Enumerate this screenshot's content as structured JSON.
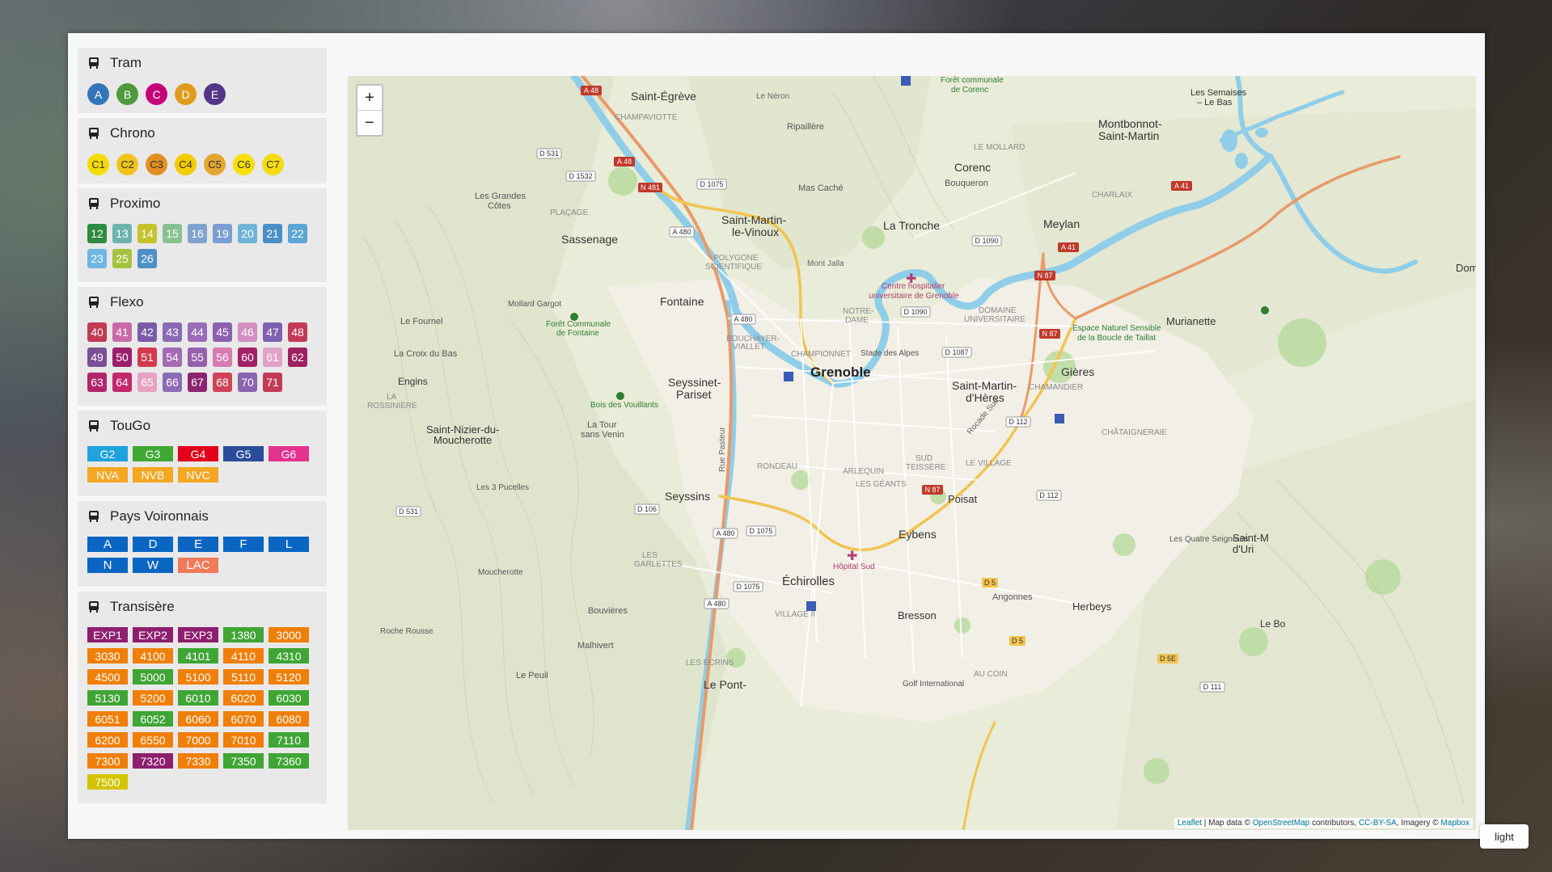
{
  "groups": {
    "tram": {
      "title": "Tram",
      "lines": [
        {
          "label": "A",
          "color": "#3376b8"
        },
        {
          "label": "B",
          "color": "#4e9a3e"
        },
        {
          "label": "C",
          "color": "#c4007a"
        },
        {
          "label": "D",
          "color": "#df9c1e"
        },
        {
          "label": "E",
          "color": "#533786"
        }
      ]
    },
    "chrono": {
      "title": "Chrono",
      "lines": [
        {
          "label": "C1",
          "color": "#f3dc00"
        },
        {
          "label": "C2",
          "color": "#f0c41a"
        },
        {
          "label": "C3",
          "color": "#e29022"
        },
        {
          "label": "C4",
          "color": "#f3cc00"
        },
        {
          "label": "C5",
          "color": "#e3a632"
        },
        {
          "label": "C6",
          "color": "#f7df0a"
        },
        {
          "label": "C7",
          "color": "#f5dc10"
        }
      ]
    },
    "proximo": {
      "title": "Proximo",
      "lines": [
        {
          "label": "12",
          "color": "#2e8b3e"
        },
        {
          "label": "13",
          "color": "#6cb3b0"
        },
        {
          "label": "14",
          "color": "#c4c42a"
        },
        {
          "label": "15",
          "color": "#86c18f"
        },
        {
          "label": "16",
          "color": "#7fa3cf"
        },
        {
          "label": "19",
          "color": "#7a9ed4"
        },
        {
          "label": "20",
          "color": "#6fb4d7"
        },
        {
          "label": "21",
          "color": "#4a8ec7"
        },
        {
          "label": "22",
          "color": "#5aa6d6"
        },
        {
          "label": "23",
          "color": "#6fb6e2"
        },
        {
          "label": "25",
          "color": "#a5c33f"
        },
        {
          "label": "26",
          "color": "#4f90c9"
        }
      ]
    },
    "flexo": {
      "title": "Flexo",
      "lines": [
        {
          "label": "40",
          "color": "#c23a55"
        },
        {
          "label": "41",
          "color": "#c86aa8"
        },
        {
          "label": "42",
          "color": "#7a5aa8"
        },
        {
          "label": "43",
          "color": "#8a6ab4"
        },
        {
          "label": "44",
          "color": "#9a6bb8"
        },
        {
          "label": "45",
          "color": "#8c5fb0"
        },
        {
          "label": "46",
          "color": "#d38fbf"
        },
        {
          "label": "47",
          "color": "#7e5fb0"
        },
        {
          "label": "48",
          "color": "#c23a55"
        },
        {
          "label": "49",
          "color": "#7a4f96"
        },
        {
          "label": "50",
          "color": "#9b1f6e"
        },
        {
          "label": "51",
          "color": "#d33a4d"
        },
        {
          "label": "54",
          "color": "#a46bb3"
        },
        {
          "label": "55",
          "color": "#9560a9"
        },
        {
          "label": "56",
          "color": "#d77ab0"
        },
        {
          "label": "60",
          "color": "#a2226a"
        },
        {
          "label": "61",
          "color": "#e1a1c8"
        },
        {
          "label": "62",
          "color": "#9d2261"
        },
        {
          "label": "63",
          "color": "#b0266c"
        },
        {
          "label": "64",
          "color": "#c3286c"
        },
        {
          "label": "65",
          "color": "#e6a2c0"
        },
        {
          "label": "66",
          "color": "#8c6bb6"
        },
        {
          "label": "67",
          "color": "#8a2570"
        },
        {
          "label": "68",
          "color": "#d0445a"
        },
        {
          "label": "70",
          "color": "#8a64ad"
        },
        {
          "label": "71",
          "color": "#c23a55"
        }
      ]
    },
    "tougo": {
      "title": "TouGo",
      "lines": [
        {
          "label": "G2",
          "color": "#1fa3dc"
        },
        {
          "label": "G3",
          "color": "#3fa834"
        },
        {
          "label": "G4",
          "color": "#e2001a"
        },
        {
          "label": "G5",
          "color": "#2a4d9b"
        },
        {
          "label": "G6",
          "color": "#e4338f"
        },
        {
          "label": "NVA",
          "color": "#f5a623"
        },
        {
          "label": "NVB",
          "color": "#f5a623"
        },
        {
          "label": "NVC",
          "color": "#f5a623"
        }
      ]
    },
    "voironnais": {
      "title": "Pays Voironnais",
      "lines": [
        {
          "label": "A",
          "color": "#0a66c2"
        },
        {
          "label": "D",
          "color": "#0a66c2"
        },
        {
          "label": "E",
          "color": "#0a66c2"
        },
        {
          "label": "F",
          "color": "#0a66c2"
        },
        {
          "label": "L",
          "color": "#0a66c2"
        },
        {
          "label": "N",
          "color": "#0a66c2"
        },
        {
          "label": "W",
          "color": "#0a66c2"
        },
        {
          "label": "LAC",
          "color": "#f07a5a"
        }
      ]
    },
    "transisere": {
      "title": "Transisère",
      "lines": [
        {
          "label": "EXP1",
          "color": "#8e1f6e"
        },
        {
          "label": "EXP2",
          "color": "#8e1f6e"
        },
        {
          "label": "EXP3",
          "color": "#8e1f6e"
        },
        {
          "label": "1380",
          "color": "#3fa535"
        },
        {
          "label": "3000",
          "color": "#f07f0a"
        },
        {
          "label": "3030",
          "color": "#f07f0a"
        },
        {
          "label": "4100",
          "color": "#f07f0a"
        },
        {
          "label": "4101",
          "color": "#3fa535"
        },
        {
          "label": "4110",
          "color": "#f07f0a"
        },
        {
          "label": "4310",
          "color": "#3fa535"
        },
        {
          "label": "4500",
          "color": "#f07f0a"
        },
        {
          "label": "5000",
          "color": "#3fa535"
        },
        {
          "label": "5100",
          "color": "#f07f0a"
        },
        {
          "label": "5110",
          "color": "#f07f0a"
        },
        {
          "label": "5120",
          "color": "#f07f0a"
        },
        {
          "label": "5130",
          "color": "#3fa535"
        },
        {
          "label": "5200",
          "color": "#f07f0a"
        },
        {
          "label": "6010",
          "color": "#3fa535"
        },
        {
          "label": "6020",
          "color": "#f07f0a"
        },
        {
          "label": "6030",
          "color": "#3fa535"
        },
        {
          "label": "6051",
          "color": "#f07f0a"
        },
        {
          "label": "6052",
          "color": "#3fa535"
        },
        {
          "label": "6060",
          "color": "#f07f0a"
        },
        {
          "label": "6070",
          "color": "#f07f0a"
        },
        {
          "label": "6080",
          "color": "#f07f0a"
        },
        {
          "label": "6200",
          "color": "#f07f0a"
        },
        {
          "label": "6550",
          "color": "#f07f0a"
        },
        {
          "label": "7000",
          "color": "#f07f0a"
        },
        {
          "label": "7010",
          "color": "#f07f0a"
        },
        {
          "label": "7110",
          "color": "#3fa535"
        },
        {
          "label": "7300",
          "color": "#f07f0a"
        },
        {
          "label": "7320",
          "color": "#8e1f6e"
        },
        {
          "label": "7330",
          "color": "#f07f0a"
        },
        {
          "label": "7350",
          "color": "#3fa535"
        },
        {
          "label": "7360",
          "color": "#3fa535"
        },
        {
          "label": "7500",
          "color": "#d4c400"
        }
      ]
    }
  },
  "map": {
    "zoom_in": "+",
    "zoom_out": "−",
    "attribution": {
      "leaflet": "Leaflet",
      "text1": " | Map data © ",
      "osm": "OpenStreetMap",
      "text2": " contributors, ",
      "license": "CC-BY-SA",
      "text3": ", Imagery © ",
      "mapbox": "Mapbox"
    },
    "places": {
      "grenoble": "Grenoble",
      "saint_egreve": "Saint-Égrève",
      "sassenage": "Sassenage",
      "fontaine": "Fontaine",
      "saint_martin_vinoux_1": "Saint-Martin-",
      "saint_martin_vinoux_2": "le-Vinoux",
      "la_tronche": "La Tronche",
      "meylan": "Meylan",
      "corenc": "Corenc",
      "montbonnot_1": "Montbonnot-",
      "montbonnot_2": "Saint-Martin",
      "seyssinet_1": "Seyssinet-",
      "seyssinet_2": "Pariset",
      "seyssins": "Seyssins",
      "echirolles": "Échirolles",
      "eybens": "Eybens",
      "poisat": "Poisat",
      "gieres": "Gières",
      "smh_1": "Saint-Martin-",
      "smh_2": "d'Hères",
      "murianette": "Murianette",
      "bresson": "Bresson",
      "herbeys": "Herbeys",
      "le_pont": "Le Pont-",
      "saint_nizier_1": "Saint-Nizier-du-",
      "saint_nizier_2": "Moucherotte",
      "engins": "Engins",
      "les_semaises_1": "Les Semaises",
      "les_semaises_2": "– Le Bas",
      "dom": "Dom",
      "saint_m_1": "Saint-M",
      "saint_m_2": "d'Uri",
      "le_bo": "Le Bo",
      "champaviotte": "CHAMPAVIOTTE",
      "placage": "PLAÇAGE",
      "le_neron": "Le Néron",
      "ripaillere": "Ripaillère",
      "mas_cache": "Mas Caché",
      "bouqueron": "Bouqueron",
      "le_mollard": "LE MOLLARD",
      "charlaix": "CHARLAIX",
      "les_grandes_cotes_1": "Les Grandes",
      "les_grandes_cotes_2": "Côtes",
      "mont_jalla": "Mont Jalla",
      "polygone_1": "POLYGONE",
      "polygone_2": "SCIENTIFIQUE",
      "chu_1": "Centre hospitalier",
      "chu_2": "universitaire de Grenoble",
      "notre_dame_1": "NOTRE-",
      "notre_dame_2": "DAME",
      "domaine_1": "DOMAINE",
      "domaine_2": "UNIVERSITAIRE",
      "espace_1": "Espace Naturel Sensible",
      "espace_2": "de la Boucle de Taillat",
      "mollard_gargot": "Mollard Gargot",
      "le_fournel": "Le Fournel",
      "foret_fontaine_1": "Forêt Communale",
      "foret_fontaine_2": "de Fontaine",
      "la_croix": "La Croix du Bas",
      "bouchayer_1": "BOUCHAYER-",
      "bouchayer_2": "VIALLET",
      "championnet": "CHAMPIONNET",
      "stade": "Stade des Alpes",
      "chamandier": "CHAMANDIER",
      "la_rossiniere_1": "LA",
      "la_rossiniere_2": "ROSSINIÈRE",
      "bois_vouillants": "Bois des Vouillants",
      "la_tour_1": "La Tour",
      "la_tour_2": "sans Venin",
      "chataigneraie": "CHÂTAIGNERAIE",
      "sud_teissere_1": "SUD",
      "sud_teissere_2": "TEISSÈRE",
      "le_village": "LE VILLAGE",
      "arlequin": "ARLEQUIN",
      "les_geants": "LES GÉANTS",
      "rondeau": "RONDEAU",
      "les_3_pucelles": "Les 3 Pucelles",
      "les_garlettes_1": "LES",
      "les_garlettes_2": "GARLETTES",
      "hopital_sud": "Hôpital Sud",
      "moucherotte": "Moucherotte",
      "bouvieres": "Bouvières",
      "malhivert": "Malhivert",
      "roche_rousse": "Roche Rousse",
      "village_ii": "VILLAGE II",
      "angonnes": "Angonnes",
      "les_quatre_seigneurs": "Les Quatre Seigneurs",
      "le_peuil": "Le Peuil",
      "les_ecrins": "LES ÉCRINS",
      "au_coin": "AU COIN",
      "golf": "Golf International",
      "foret_corenc_1": "Forêt communale",
      "foret_corenc_2": "de Corenc",
      "rocade_sud": "Rocade Sud",
      "rue_pasteur": "Rue Pasteur"
    },
    "roads": {
      "a48a": "A 48",
      "a48b": "A 48",
      "d531a": "D 531",
      "d1532": "D 1532",
      "n481": "N 481",
      "d1075a": "D 1075",
      "a480a": "A 480",
      "a480b": "A 480",
      "d1090a": "D 1090",
      "d1090b": "D 1090",
      "a41a": "A 41",
      "a41b": "A 41",
      "n87a": "N 87",
      "n87b": "N 87",
      "n87c": "N 87",
      "d1087": "D 1087",
      "d112a": "D 112",
      "d112b": "D 112",
      "d531b": "D 531",
      "d106": "D 106",
      "a480c": "A 480",
      "d1075b": "D 1075",
      "d1075c": "D 1075",
      "a480d": "A 480",
      "d5a": "D 5",
      "d5b": "D 5",
      "d5e": "D 5E",
      "d111": "D 111"
    }
  },
  "theme_button": "light"
}
